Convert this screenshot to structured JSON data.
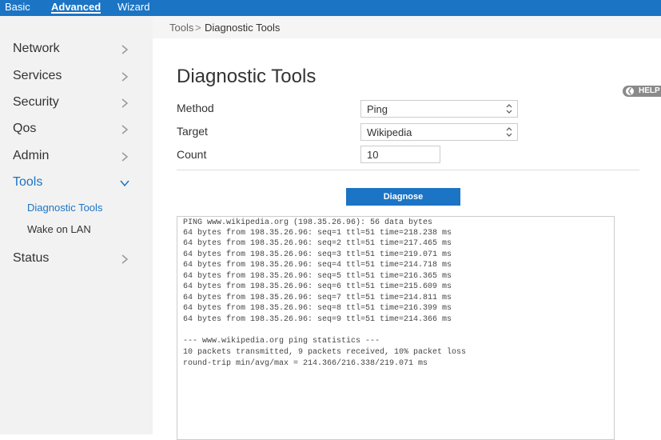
{
  "topnav": {
    "basic": "Basic",
    "advanced": "Advanced",
    "wizard": "Wizard"
  },
  "sidebar": {
    "items": [
      {
        "label": "Network"
      },
      {
        "label": "Services"
      },
      {
        "label": "Security"
      },
      {
        "label": "Qos"
      },
      {
        "label": "Admin"
      },
      {
        "label": "Tools"
      },
      {
        "label": "Status"
      }
    ],
    "tools_sub": [
      "Diagnostic Tools",
      "Wake on LAN"
    ]
  },
  "breadcrumb": {
    "parent": "Tools",
    "separator": ">",
    "current": "Diagnostic Tools"
  },
  "page": {
    "title": "Diagnostic Tools",
    "help": "HELP",
    "form": {
      "method_label": "Method",
      "method_value": "Ping",
      "target_label": "Target",
      "target_value": "Wikipedia",
      "count_label": "Count",
      "count_value": "10"
    },
    "diagnose_label": "Diagnose"
  },
  "output": {
    "lines": [
      "PING www.wikipedia.org (198.35.26.96): 56 data bytes",
      "64 bytes from 198.35.26.96: seq=1 ttl=51 time=218.238 ms",
      "64 bytes from 198.35.26.96: seq=2 ttl=51 time=217.465 ms",
      "64 bytes from 198.35.26.96: seq=3 ttl=51 time=219.071 ms",
      "64 bytes from 198.35.26.96: seq=4 ttl=51 time=214.718 ms",
      "64 bytes from 198.35.26.96: seq=5 ttl=51 time=216.365 ms",
      "64 bytes from 198.35.26.96: seq=6 ttl=51 time=215.609 ms",
      "64 bytes from 198.35.26.96: seq=7 ttl=51 time=214.811 ms",
      "64 bytes from 198.35.26.96: seq=8 ttl=51 time=216.399 ms",
      "64 bytes from 198.35.26.96: seq=9 ttl=51 time=214.366 ms",
      "",
      "--- www.wikipedia.org ping statistics ---",
      "10 packets transmitted, 9 packets received, 10% packet loss",
      "round-trip min/avg/max = 214.366/216.338/219.071 ms"
    ]
  },
  "colors": {
    "accent": "#1b74c4",
    "sidebar_bg": "#f2f2f2",
    "help_badge": "#8a8a8a"
  }
}
